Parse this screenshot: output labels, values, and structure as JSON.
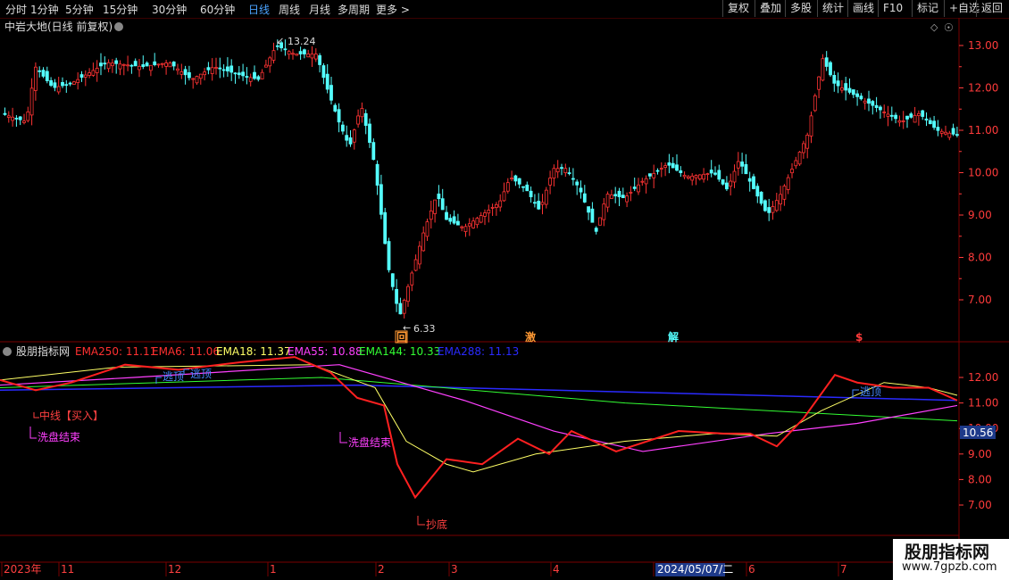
{
  "toolbar": {
    "periods": [
      "分时",
      "1分钟",
      "5分钟",
      "15分钟",
      "30分钟",
      "60分钟",
      "日线",
      "周线",
      "月线",
      "多周期",
      "更多 >"
    ],
    "active": "日线",
    "right_buttons": [
      "复权",
      "叠加",
      "多股",
      "统计",
      "画线",
      "F10",
      "标记",
      "+自选",
      "返回"
    ]
  },
  "main_panel": {
    "title": "中岩大地(日线 前复权)",
    "high_label": "13.24",
    "low_label": "6.33",
    "y_ticks": [
      "13.00",
      "12.00",
      "11.00",
      "10.00",
      "9.00",
      "8.00",
      "7.00"
    ],
    "markers": [
      "回",
      "激",
      "解",
      "$"
    ]
  },
  "indicator_panel": {
    "name": "股朋指标网",
    "legend": [
      {
        "label": "EMA250: 11.11",
        "color": "#ff3030"
      },
      {
        "label": "EMA6: 11.06",
        "color": "#ff3030"
      },
      {
        "label": "EMA18: 11.37",
        "color": "#ffff66"
      },
      {
        "label": "EMA55: 10.88",
        "color": "#ff40ff"
      },
      {
        "label": "EMA144: 10.33",
        "color": "#33ff33"
      },
      {
        "label": "EMA288: 11.13",
        "color": "#2a2aff"
      }
    ],
    "y_ticks": [
      "12.00",
      "11.00",
      "10.00",
      "9.00",
      "8.00",
      "7.00"
    ],
    "current_value": "10.56",
    "annotations": {
      "escape_top": "逃顶",
      "mid_buy": "中线【买入】",
      "washout_end": "洗盘结束",
      "bottom": "抄底"
    }
  },
  "time_axis": {
    "labels": [
      "2023年",
      "11",
      "12",
      "1",
      "2",
      "3",
      "4",
      "5",
      "6",
      "7"
    ],
    "cursor_date": "2024/05/07/二"
  },
  "watermark": {
    "title": "股朋指标网",
    "url": "www.7gpzb.com"
  },
  "colors": {
    "up": "#ff3333",
    "down": "#54ffff",
    "grid": "#7a0000",
    "axis_text": "#ff3b3b"
  }
}
